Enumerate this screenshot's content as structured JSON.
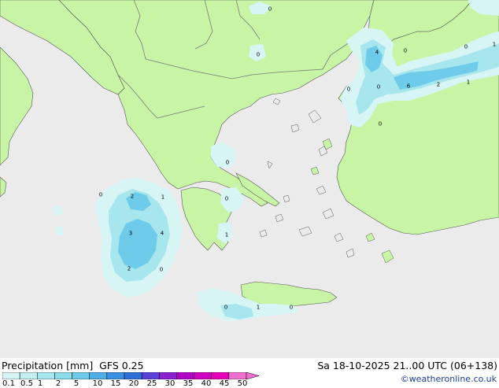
{
  "header": {
    "title": "Precipitation [mm]",
    "model": "GFS 0.25",
    "valid_time": "Sa 18-10-2025 21..00 UTC (06+138)",
    "credit": "©weatheronline.co.uk"
  },
  "legend": {
    "ticks": [
      "0.1",
      "0.5",
      "1",
      "2",
      "5",
      "10",
      "15",
      "20",
      "25",
      "30",
      "35",
      "40",
      "45",
      "50"
    ],
    "colors": [
      "#d8f5f5",
      "#c2eef2",
      "#a8e6ee",
      "#8cdcec",
      "#6ecbea",
      "#4eaee6",
      "#3b8fe0",
      "#2f6fd8",
      "#5a40d8",
      "#8a20d0",
      "#b000c8",
      "#d000c0",
      "#e800b8",
      "#f070d0"
    ]
  },
  "colors": {
    "sea": "#ebebeb",
    "land": "#c7f5a5",
    "border": "#7a7a7a",
    "coast": "#555555"
  },
  "map_labels": [
    {
      "text": "0"
    },
    {
      "text": "0"
    },
    {
      "text": "4"
    },
    {
      "text": "0"
    },
    {
      "text": "0"
    },
    {
      "text": "1"
    },
    {
      "text": "0"
    },
    {
      "text": "0"
    },
    {
      "text": "6"
    },
    {
      "text": "2"
    },
    {
      "text": "1"
    },
    {
      "text": "0"
    },
    {
      "text": "0"
    },
    {
      "text": "0"
    },
    {
      "text": "2"
    },
    {
      "text": "1"
    },
    {
      "text": "0"
    },
    {
      "text": "3"
    },
    {
      "text": "4"
    },
    {
      "text": "1"
    },
    {
      "text": "2"
    },
    {
      "text": "0"
    },
    {
      "text": "0"
    },
    {
      "text": "1"
    },
    {
      "text": "0"
    }
  ]
}
